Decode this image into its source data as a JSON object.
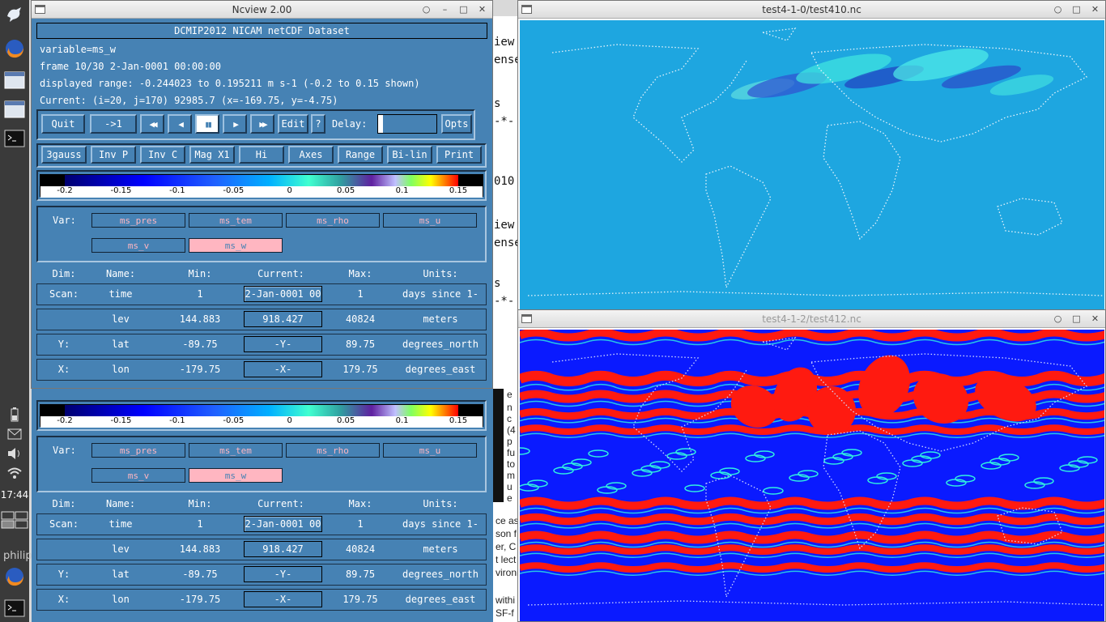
{
  "dock": {
    "clock": "17:44",
    "user": "philip"
  },
  "background_doc": {
    "lines": [
      "iew",
      "ense",
      "s",
      "-*-",
      "010",
      "iew",
      "ense",
      "s",
      "-*-"
    ],
    "lines2": [
      "e",
      "n",
      "c",
      "(4",
      "p",
      "fu",
      "to",
      "m",
      "u",
      "e",
      "ce as",
      "son f",
      "er, C",
      "t lect",
      "vironm",
      "withi",
      "SF-f"
    ]
  },
  "ncview": {
    "title": "Ncview 2.00",
    "dataset_title": "DCMIP2012 NICAM netCDF Dataset",
    "variable_line": "variable=ms_w",
    "frame_line": "frame 10/30 2-Jan-0001 00:00:00",
    "range_line": "displayed range: -0.244023 to 0.195211 m s-1 (-0.2 to 0.15 shown)",
    "current_line": "Current: (i=20, j=170) 92985.7 (x=-169.75, y=-4.75)",
    "controls": {
      "quit": "Quit",
      "reset": "->1",
      "rewind_icon": "fast-backward-icon",
      "back_icon": "step-back-icon",
      "pause_icon": "pause-icon",
      "forward_icon": "step-forward-icon",
      "ffwd_icon": "fast-forward-icon",
      "edit": "Edit",
      "help": "?",
      "delay_label": "Delay:",
      "opts": "Opts"
    },
    "options": [
      "3gauss",
      "Inv P",
      "Inv C",
      "Mag X1",
      "Hi",
      "Axes",
      "Range",
      "Bi-lin",
      "Print"
    ],
    "colorbar_ticks": [
      {
        "label": "-0.2",
        "value": -0.2
      },
      {
        "label": "-0.15",
        "value": -0.15
      },
      {
        "label": "-0.1",
        "value": -0.1
      },
      {
        "label": "-0.05",
        "value": -0.05
      },
      {
        "label": "0",
        "value": 0
      },
      {
        "label": "0.05",
        "value": 0.05
      },
      {
        "label": "0.1",
        "value": 0.1
      },
      {
        "label": "0.15",
        "value": 0.15
      }
    ],
    "var_label": "Var:",
    "variables": [
      "ms_pres",
      "ms_tem",
      "ms_rho",
      "ms_u",
      "ms_v",
      "ms_w"
    ],
    "selected_variable": "ms_w",
    "dim_headers": {
      "dim": "Dim:",
      "name": "Name:",
      "min": "Min:",
      "current": "Current:",
      "max": "Max:",
      "units": "Units:"
    },
    "dims": [
      {
        "dim": "Scan:",
        "name": "time",
        "min": "1",
        "current": "2-Jan-0001 00",
        "max": "1",
        "units": "days since 1-"
      },
      {
        "dim": "",
        "name": "lev",
        "min": "144.883",
        "current": "918.427",
        "max": "40824",
        "units": "meters"
      },
      {
        "dim": "Y:",
        "name": "lat",
        "min": "-89.75",
        "current": "-Y-",
        "max": "89.75",
        "units": "degrees_north"
      },
      {
        "dim": "X:",
        "name": "lon",
        "min": "-179.75",
        "current": "-X-",
        "max": "179.75",
        "units": "degrees_east"
      }
    ]
  },
  "map_top": {
    "title": "test4-1-0/test410.nc",
    "base_color": "#1ea6e0"
  },
  "map_bottom": {
    "title": "test4-1-2/test412.nc",
    "colors": {
      "blue": "#0a1aff",
      "red": "#ff1a10",
      "cyan": "#30f0e0"
    }
  }
}
